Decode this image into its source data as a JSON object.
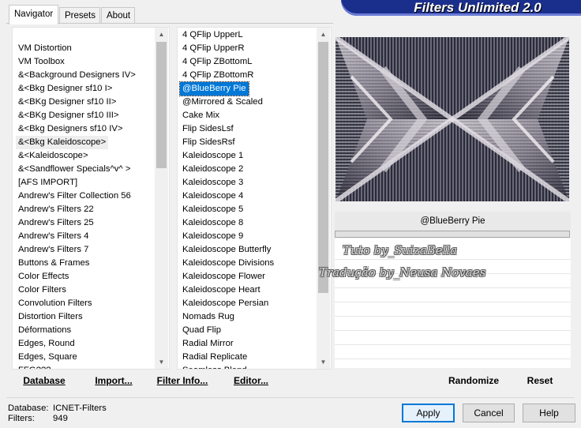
{
  "tabs": [
    "Navigator",
    "Presets",
    "About"
  ],
  "banner_title": "Filters Unlimited 2.0",
  "categories": {
    "items": [
      "VM Distortion",
      "VM Toolbox",
      "&<Background Designers IV>",
      "&<Bkg Designer sf10 I>",
      "&<BKg Designer sf10 II>",
      "&<BKg Designer sf10 III>",
      "&<Bkg Designers sf10 IV>",
      "&<Bkg Kaleidoscope>",
      "&<Kaleidoscope>",
      "&<Sandflower Specials^v^ >",
      "[AFS IMPORT]",
      "Andrew's Filter Collection 56",
      "Andrew's Filters 22",
      "Andrew's Filters 25",
      "Andrew's Filters 4",
      "Andrew's Filters 7",
      "Buttons & Frames",
      "Color Effects",
      "Color Filters",
      "Convolution Filters",
      "Distortion Filters",
      "Déformations",
      "Edges, Round",
      "Edges, Square",
      "FFG???"
    ],
    "highlighted_index": 7
  },
  "filters": {
    "items": [
      "4 QFlip UpperL",
      "4 QFlip UpperR",
      "4 QFlip ZBottomL",
      "4 QFlip ZBottomR",
      "@BlueBerry Pie",
      "@Mirrored & Scaled",
      "Cake Mix",
      "Flip SidesLsf",
      "Flip SidesRsf",
      "Kaleidoscope 1",
      "Kaleidoscope 2",
      "Kaleidoscope 3",
      "Kaleidoscope 4",
      "Kaleidoscope 5",
      "Kaleidoscope 8",
      "Kaleidoscope 9",
      "Kaleidoscope Butterfly",
      "Kaleidoscope Divisions",
      "Kaleidoscope Flower",
      "Kaleidoscope Heart",
      "Kaleidoscope Persian",
      "Nomads Rug",
      "Quad Flip",
      "Radial Mirror",
      "Radial Replicate",
      "Seamless Blend"
    ],
    "selected_index": 4
  },
  "toolbar": {
    "database": "Database",
    "import": "Import...",
    "filter_info": "Filter Info...",
    "editor": "Editor...",
    "randomize": "Randomize",
    "reset": "Reset"
  },
  "preview": {
    "filter_name": "@BlueBerry Pie"
  },
  "watermark": {
    "line1": "Tuto by_SuizaBella",
    "line2": "Tradução by_Neusa Novaes"
  },
  "footer": {
    "database_label": "Database:",
    "database_value": "ICNET-Filters",
    "filters_label": "Filters:",
    "filters_value": "949"
  },
  "buttons": {
    "apply": "Apply",
    "cancel": "Cancel",
    "help": "Help"
  },
  "colors": {
    "banner": "#1a2e8c",
    "selection": "#0078d7"
  }
}
